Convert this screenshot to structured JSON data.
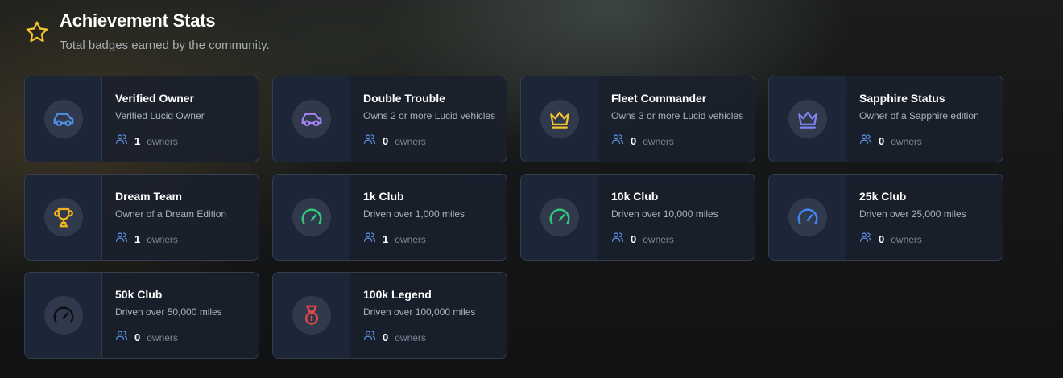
{
  "header": {
    "title": "Achievement Stats",
    "subtitle": "Total badges earned by the community.",
    "icon": "star-icon",
    "icon_color": "#f2c230"
  },
  "owners_label": "owners",
  "badges": [
    {
      "name": "Verified Owner",
      "description": "Verified Lucid Owner",
      "count": "1",
      "icon": "car",
      "color": "#4f8fe6"
    },
    {
      "name": "Double Trouble",
      "description": "Owns 2 or more Lucid vehicles",
      "count": "0",
      "icon": "car",
      "color": "#a880f0"
    },
    {
      "name": "Fleet Commander",
      "description": "Owns 3 or more Lucid vehicles",
      "count": "0",
      "icon": "crown",
      "color": "#f2c230"
    },
    {
      "name": "Sapphire Status",
      "description": "Owner of a Sapphire edition",
      "count": "0",
      "icon": "crown",
      "color": "#7c86f0"
    },
    {
      "name": "Dream Team",
      "description": "Owner of a Dream Edition",
      "count": "1",
      "icon": "trophy",
      "color": "#f2b21c"
    },
    {
      "name": "1k Club",
      "description": "Driven over 1,000 miles",
      "count": "1",
      "icon": "gauge",
      "color": "#34c77a"
    },
    {
      "name": "10k Club",
      "description": "Driven over 10,000 miles",
      "count": "0",
      "icon": "gauge",
      "color": "#34c77a"
    },
    {
      "name": "25k Club",
      "description": "Driven over 25,000 miles",
      "count": "0",
      "icon": "gauge",
      "color": "#3f86f0"
    },
    {
      "name": "50k Club",
      "description": "Driven over 50,000 miles",
      "count": "0",
      "icon": "gauge",
      "color": "#0e1014"
    },
    {
      "name": "100k Legend",
      "description": "Driven over 100,000 miles",
      "count": "0",
      "icon": "medal",
      "color": "#e5484d"
    }
  ],
  "colors": {
    "owners_icon": "#5f95e8"
  }
}
